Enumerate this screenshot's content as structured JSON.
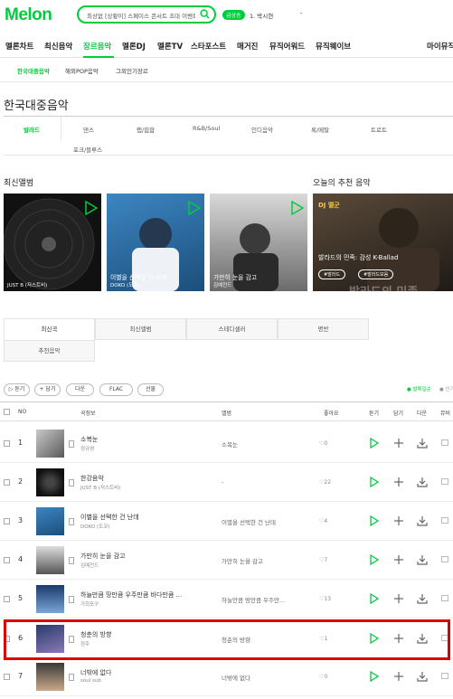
{
  "header": {
    "logo": "Melon",
    "search_placeholder": "최상없 [상황이] 스페이스 콘서트 초대 이벤트",
    "live_badge": "급상승",
    "realtime_rank": "1. 박시현",
    "realtime_dash": "-"
  },
  "gnb": [
    "멜론차트",
    "최신음악",
    "장르음악",
    "멜론DJ",
    "멜론TV",
    "스타포스트",
    "매거진",
    "뮤직어워드",
    "뮤직웨이브",
    "마이뮤직"
  ],
  "subnav": [
    "한국대중음악",
    "해외POP음악",
    "그외인기장르"
  ],
  "page_title": "한국대중음악",
  "genres": [
    "발라드",
    "댄스",
    "랩/힙합",
    "R&B/Soul",
    "인디음악",
    "록/메탈",
    "트로트",
    "포크/블루스"
  ],
  "sections": {
    "latest_albums": "최신앨범",
    "recommended": "오늘의 추천 음악"
  },
  "album_cards": [
    {
      "title": "",
      "artist": "JUST B (저스트비)"
    },
    {
      "title": "이별을 선택한 건 난데",
      "artist": "DOKO (도코)"
    },
    {
      "title": "가만히 눈을 감고",
      "artist": "김예전드"
    }
  ],
  "recommend_card": {
    "dj": "DJ 멜군",
    "title": "발라드의 민족: 감성 K-Ballad",
    "tags": [
      "#발라드",
      "#발라드모음"
    ],
    "watermark": "발라드의 민족"
  },
  "tabs": [
    "최신곡",
    "최신앨범",
    "스테디셀러",
    "명반",
    "추천음악"
  ],
  "actions": [
    "▷ 듣기",
    "+ 담기",
    "다운",
    "FLAC",
    "선물"
  ],
  "legend": [
    "● 발매일순",
    "● 인기"
  ],
  "table_headers": {
    "no": "NO",
    "song": "곡정보",
    "album": "앨범",
    "like": "좋아요",
    "listen": "듣기",
    "add": "담기",
    "down": "다운",
    "mv": "뮤비"
  },
  "songs": [
    {
      "rank": "1",
      "title": "소복눈",
      "artist": "정규영",
      "album": "소복눈",
      "likes": "0"
    },
    {
      "rank": "2",
      "title": "한강음악",
      "artist": "JUST B (저스트비)",
      "album": "-",
      "likes": "22"
    },
    {
      "rank": "3",
      "title": "이별을 선택한 건 난데",
      "artist": "DOKO (도코)",
      "album": "이별을 선택한 건 난데",
      "likes": "4"
    },
    {
      "rank": "4",
      "title": "가만히 눈을 감고",
      "artist": "김예전드",
      "album": "가만히 눈을 감고",
      "likes": "7"
    },
    {
      "rank": "5",
      "title": "하늘만큼 땅만큼 우주만큼 바다만큼 ...",
      "artist": "가희포구",
      "album": "하늘만큼 땅만큼 우주만...",
      "likes": "13"
    },
    {
      "rank": "6",
      "title": "청춘의 방향",
      "artist": "정주",
      "album": "청춘의 방향",
      "likes": "1"
    },
    {
      "rank": "7",
      "title": "너밖에 없다",
      "artist": "soul sub",
      "album": "너밖에 없다",
      "likes": "0"
    }
  ],
  "colors": {
    "accent": "#00cd3c",
    "highlight": "#dd0000"
  }
}
